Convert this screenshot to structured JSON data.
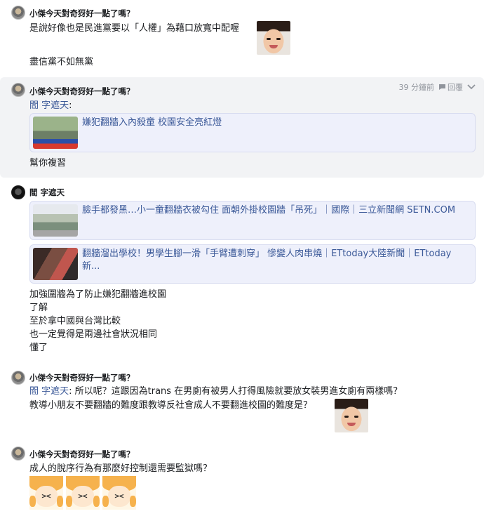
{
  "posts": [
    {
      "author": "小傑今天對奇犽好一點了嗎？",
      "lines": [
        "是說好像也是民進黨要以「人權」為藉口放寬中配喔",
        "盡信黨不如無黨"
      ]
    },
    {
      "author": "小傑今天對奇犽好一點了嗎？",
      "time": "39 分鐘前",
      "reply_label": "回覆",
      "mention": "閻 字遮天",
      "mention_suffix": ":",
      "card_title": "嫌犯翻牆入內殺童 校園安全亮紅燈",
      "lines": [
        "幫你複習"
      ]
    },
    {
      "author": "閻 字遮天",
      "cards": [
        {
          "title": "臉手都發黑…小一童翻牆衣被勾住 面朝外掛校園牆「吊死」｜國際｜三立新聞網 SETN.COM"
        },
        {
          "title": "翻牆溜出學校！男學生腳一滑「手臂遭刺穿」 慘變人肉串燒｜ETtoday大陸新聞｜ETtoday新..."
        }
      ],
      "lines": [
        "加強圍牆為了防止嫌犯翻牆進校園",
        "了解",
        "至於拿中國與台灣比較",
        "也一定覺得是兩邊社會狀況相同",
        "懂了"
      ]
    },
    {
      "author": "小傑今天對奇犽好一點了嗎？",
      "mention": "閻 字遮天",
      "mention_suffix": ": 所以呢？這跟因為trans 在男廁有被男人打得風險就要放女裝男進女廁有兩樣嗎？",
      "lines": [
        "教導小朋友不要翻牆的難度跟教導反社會成人不要翻進校園的難度是？"
      ]
    },
    {
      "author": "小傑今天對奇犽好一點了嗎？",
      "lines": [
        "成人的脫序行為有那麼好控制還需要監獄嗎？"
      ],
      "sticker_glyph": "><"
    }
  ],
  "icons": {
    "reply": "reply-bubble-icon",
    "more": "chevron-down-icon"
  },
  "colors": {
    "link": "#3b5998",
    "card_bg": "#eef0fb",
    "highlight_bg": "#f2f3f5",
    "meta": "#90949c"
  }
}
